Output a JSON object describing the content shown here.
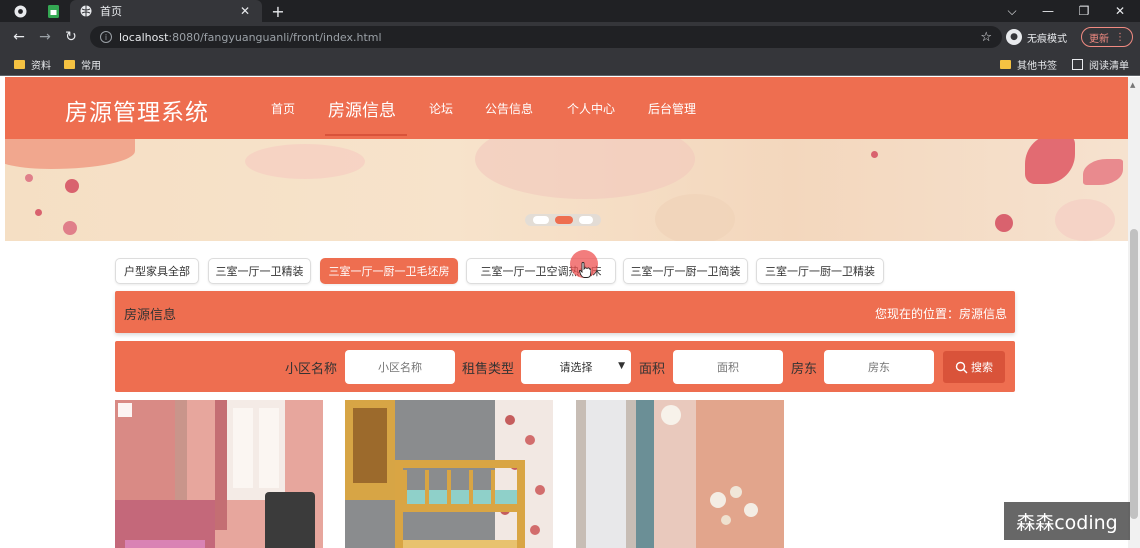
{
  "browser": {
    "tab_title": "首页",
    "url_host": "localhost",
    "url_path": ":8080/fangyuanguanli/front/index.html",
    "incognito_label": "无痕模式",
    "update_label": "更新",
    "bookmarks": [
      "资料",
      "常用"
    ],
    "bookmarks_right": [
      "其他书签",
      "阅读清单"
    ]
  },
  "site": {
    "title": "房源管理系统",
    "nav": [
      {
        "label": "首页"
      },
      {
        "label": "房源信息",
        "active": true
      },
      {
        "label": "论坛"
      },
      {
        "label": "公告信息"
      },
      {
        "label": "个人中心"
      },
      {
        "label": "后台管理"
      }
    ]
  },
  "categories": [
    {
      "label": "户型家具全部"
    },
    {
      "label": "三室一厅一卫精装"
    },
    {
      "label": "三室一厅一厨一卫毛坯房",
      "active": true
    },
    {
      "label": "三室一厅一卫空调热水床"
    },
    {
      "label": "三室一厅一厨一卫简装"
    },
    {
      "label": "三室一厅一厨一卫精装"
    }
  ],
  "info_bar": {
    "title": "房源信息",
    "breadcrumb": "您现在的位置：房源信息"
  },
  "search": {
    "community_label": "小区名称",
    "community_placeholder": "小区名称",
    "rent_type_label": "租售类型",
    "rent_type_value": "请选择",
    "area_label": "面积",
    "area_placeholder": "面积",
    "landlord_label": "房东",
    "landlord_placeholder": "房东",
    "button_label": "搜索"
  },
  "watermark": "森森coding",
  "colors": {
    "brand": "#ee6e50",
    "brand_dark": "#d9533a"
  }
}
